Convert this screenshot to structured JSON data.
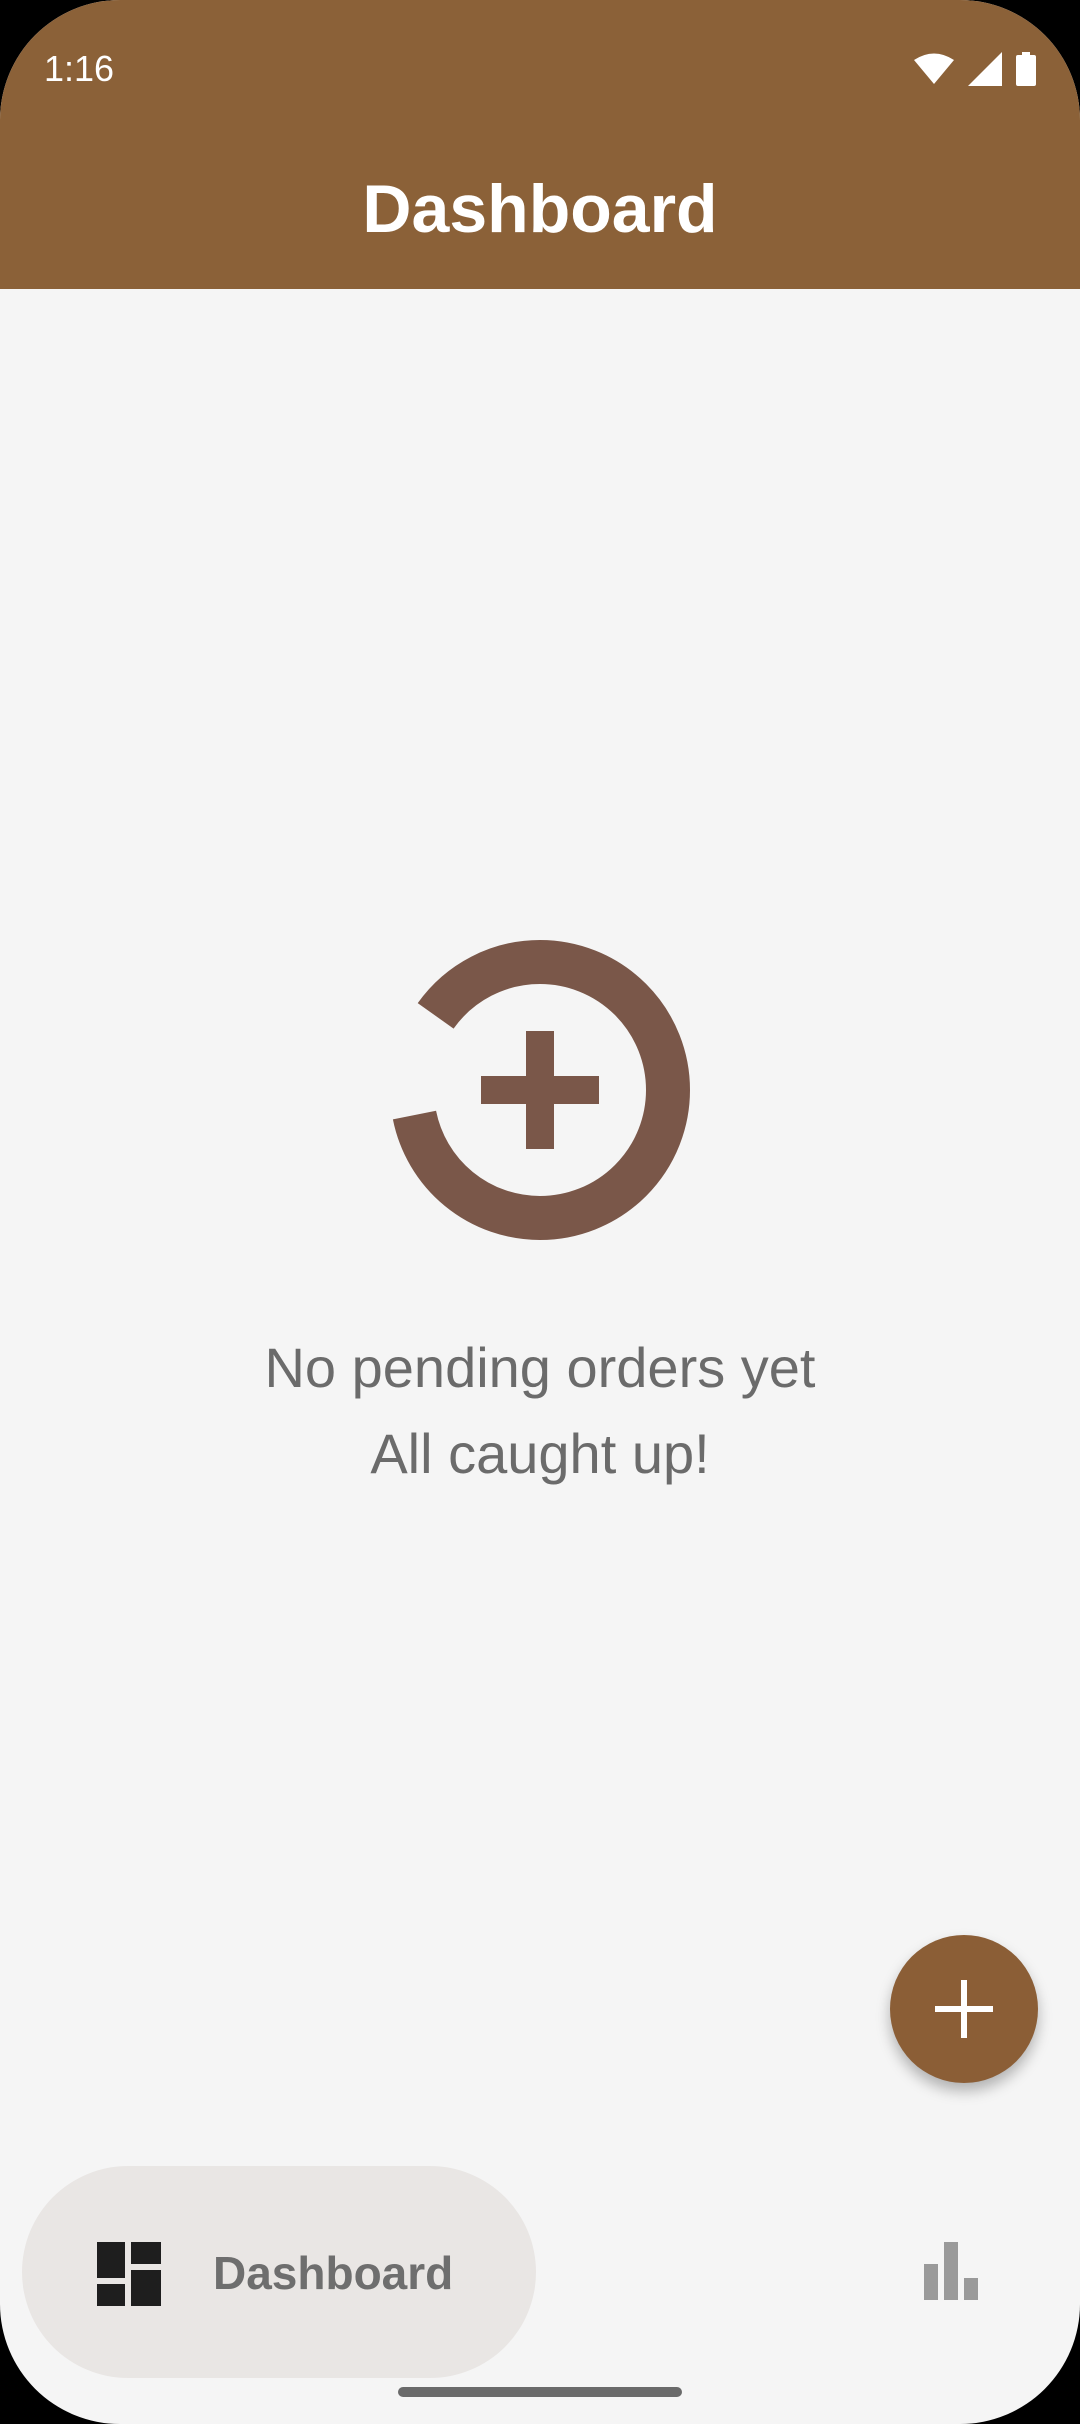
{
  "status_bar": {
    "time": "1:16",
    "icons": [
      "wifi-icon",
      "signal-icon",
      "battery-icon"
    ]
  },
  "app_bar": {
    "title": "Dashboard",
    "color": "#8B6138"
  },
  "empty_state": {
    "icon": "add-order-circle-icon",
    "icon_color": "#7A5749",
    "line1": "No pending orders yet",
    "line2": "All caught up!"
  },
  "fab": {
    "icon": "plus-icon",
    "color": "#8B5E36"
  },
  "bottom_nav": {
    "items": [
      {
        "label": "Dashboard",
        "icon": "dashboard-icon",
        "active": true
      },
      {
        "label": "",
        "icon": "bar-chart-icon",
        "active": false
      }
    ]
  }
}
